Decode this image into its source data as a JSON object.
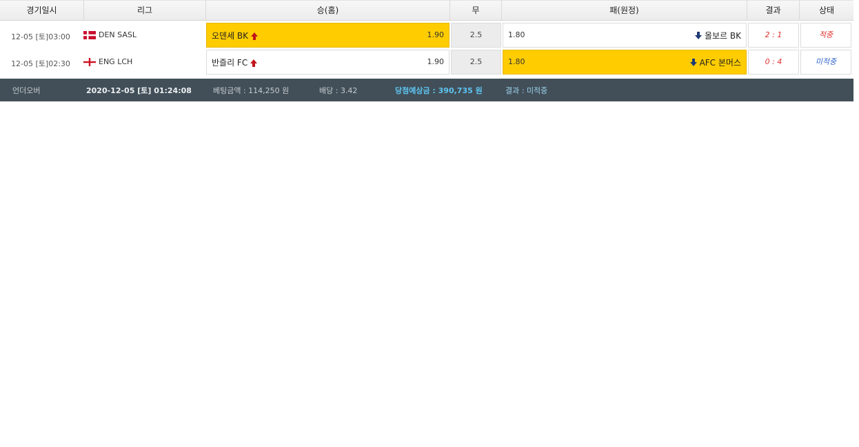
{
  "header": {
    "col_date": "경기일시",
    "col_league": "리그",
    "col_home": "승(홈)",
    "col_draw": "무",
    "col_away": "패(원정)",
    "col_result": "결과",
    "col_status": "상태"
  },
  "rows": [
    {
      "time": "12-05 [토]03:00",
      "league": "DEN SASL",
      "flag": "denmark-flag",
      "home_team": "오덴세 BK",
      "home_odds": "1.90",
      "draw": "2.5",
      "away_odds": "1.80",
      "away_team": "올보르 BK",
      "result": "2 : 1",
      "status": "적중",
      "selected": "home"
    },
    {
      "time": "12-05 [토]02:30",
      "league": "ENG LCH",
      "flag": "england-flag",
      "home_team": "반즐리 FC",
      "home_odds": "1.90",
      "draw": "2.5",
      "away_odds": "1.80",
      "away_team": "AFC 본머스",
      "result": "0 : 4",
      "status": "미적중",
      "selected": "away"
    }
  ],
  "summary": {
    "type": "언더오버",
    "datetime": "2020-12-05 [토] 01:24:08",
    "bet_amount": "베팅금액 : 114,250 원",
    "odds": "배당 : 3.42",
    "expected": "당첨예상금 : 390,735 원",
    "result": "결과 : 미적중"
  },
  "colors": {
    "selected": "#ffcc00",
    "win": "#e03030",
    "lose": "#3366cc",
    "summary_bg": "#424f58",
    "up_arrow": "#c0141b",
    "down_arrow": "#1f3b73"
  }
}
